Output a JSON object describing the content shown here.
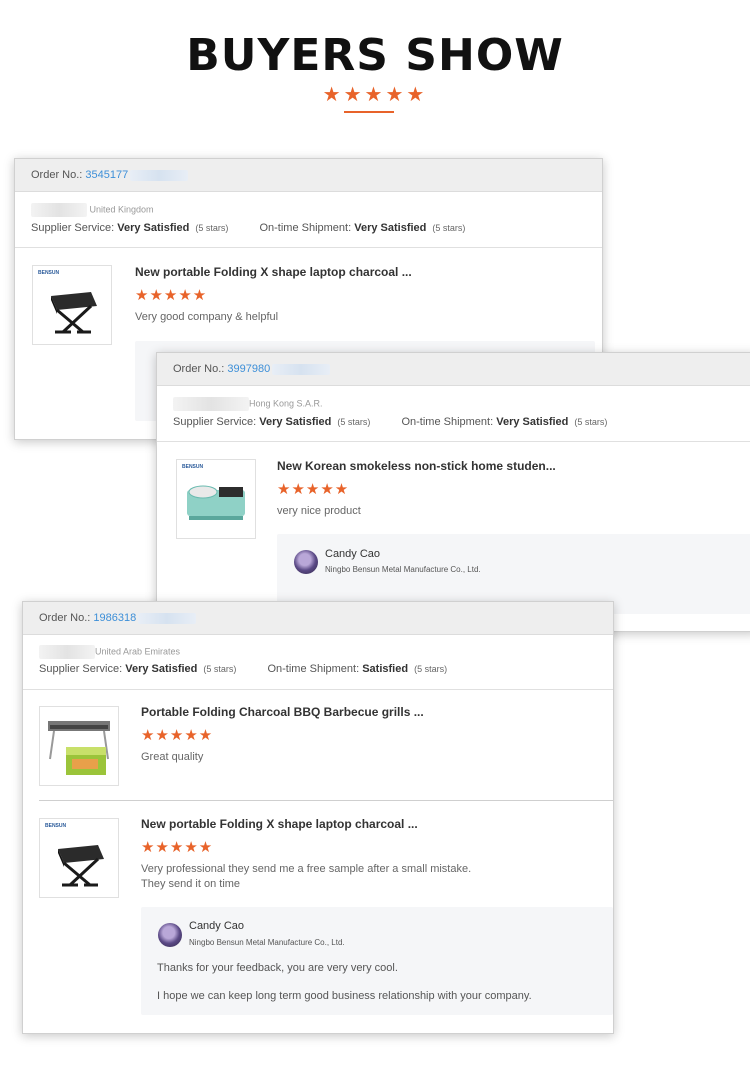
{
  "header": {
    "title": "BUYERS SHOW",
    "stars": "★★★★★",
    "accent_color": "#e8632a"
  },
  "cards": [
    {
      "order_label": "Order No.:",
      "order_number": "3545177",
      "buyer_country": "United Kingdom",
      "supplier_service_label": "Supplier Service:",
      "supplier_service_value": "Very Satisfied",
      "supplier_service_stars": "(5 stars)",
      "shipment_label": "On-time Shipment:",
      "shipment_value": "Very Satisfied",
      "shipment_stars": "(5 stars)",
      "items": [
        {
          "icon": "folding-grill-image",
          "title": "New portable Folding X shape laptop charcoal ...",
          "rating": "★★★★★",
          "comment": "Very good company & helpful"
        }
      ]
    },
    {
      "order_label": "Order No.:",
      "order_number": "3997980",
      "buyer_country": "Hong Kong S.A.R.",
      "supplier_service_label": "Supplier Service:",
      "supplier_service_value": "Very Satisfied",
      "supplier_service_stars": "(5 stars)",
      "shipment_label": "On-time Shipment:",
      "shipment_value": "Very Satisfied",
      "shipment_stars": "(5 stars)",
      "items": [
        {
          "icon": "hotpot-grill-image",
          "title": "New Korean smokeless non-stick home studen...",
          "rating": "★★★★★",
          "comment": "very nice product",
          "reply": {
            "name": "Candy Cao",
            "company": "Ningbo Bensun Metal Manufacture Co., Ltd."
          }
        }
      ]
    },
    {
      "order_label": "Order No.:",
      "order_number": "1986318",
      "buyer_country": "United Arab Emirates",
      "supplier_service_label": "Supplier Service:",
      "supplier_service_value": "Very Satisfied",
      "supplier_service_stars": "(5 stars)",
      "shipment_label": "On-time Shipment:",
      "shipment_value": "Satisfied",
      "shipment_stars": "(5 stars)",
      "items": [
        {
          "icon": "bbq-grill-image",
          "title": "Portable Folding Charcoal BBQ Barbecue grills ...",
          "rating": "★★★★★",
          "comment": "Great quality"
        },
        {
          "icon": "folding-grill-image",
          "title": "New portable Folding X shape laptop charcoal ...",
          "rating": "★★★★★",
          "comment_line1": "Very professional they send me a free sample after a small mistake.",
          "comment_line2": "They send it on time",
          "reply": {
            "name": "Candy Cao",
            "company": "Ningbo Bensun Metal Manufacture Co., Ltd.",
            "line1": "Thanks for your feedback,  you are very very  cool.",
            "line2": "I hope we can keep long term good business relationship with your  company."
          }
        }
      ]
    }
  ]
}
